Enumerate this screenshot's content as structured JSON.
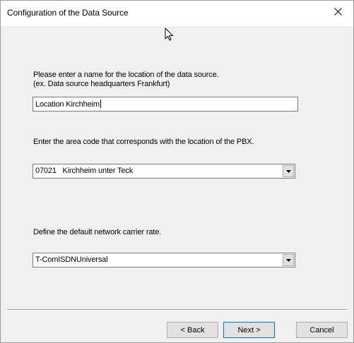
{
  "window": {
    "title": "Configuration of the Data Source",
    "close_glyph": "×"
  },
  "location": {
    "prompt_line1": "Please enter a name for the location of the data source.",
    "prompt_line2": "(ex. Data source headquarters Frankfurt)",
    "value": "Location Kirchheim"
  },
  "area_code": {
    "prompt": "Enter the area code that corresponds with the location of the PBX.",
    "selected": "07021   Kirchheim unter Teck"
  },
  "carrier": {
    "prompt": "Define the default network carrier rate.",
    "selected": "T-ComISDNUniversal"
  },
  "buttons": {
    "back_label": "< Back",
    "next_label": "Next >",
    "cancel_label": "Cancel"
  },
  "icons": {
    "close": "close-icon",
    "dropdown": "chevron-down-icon",
    "cursor": "mouse-pointer-icon"
  }
}
